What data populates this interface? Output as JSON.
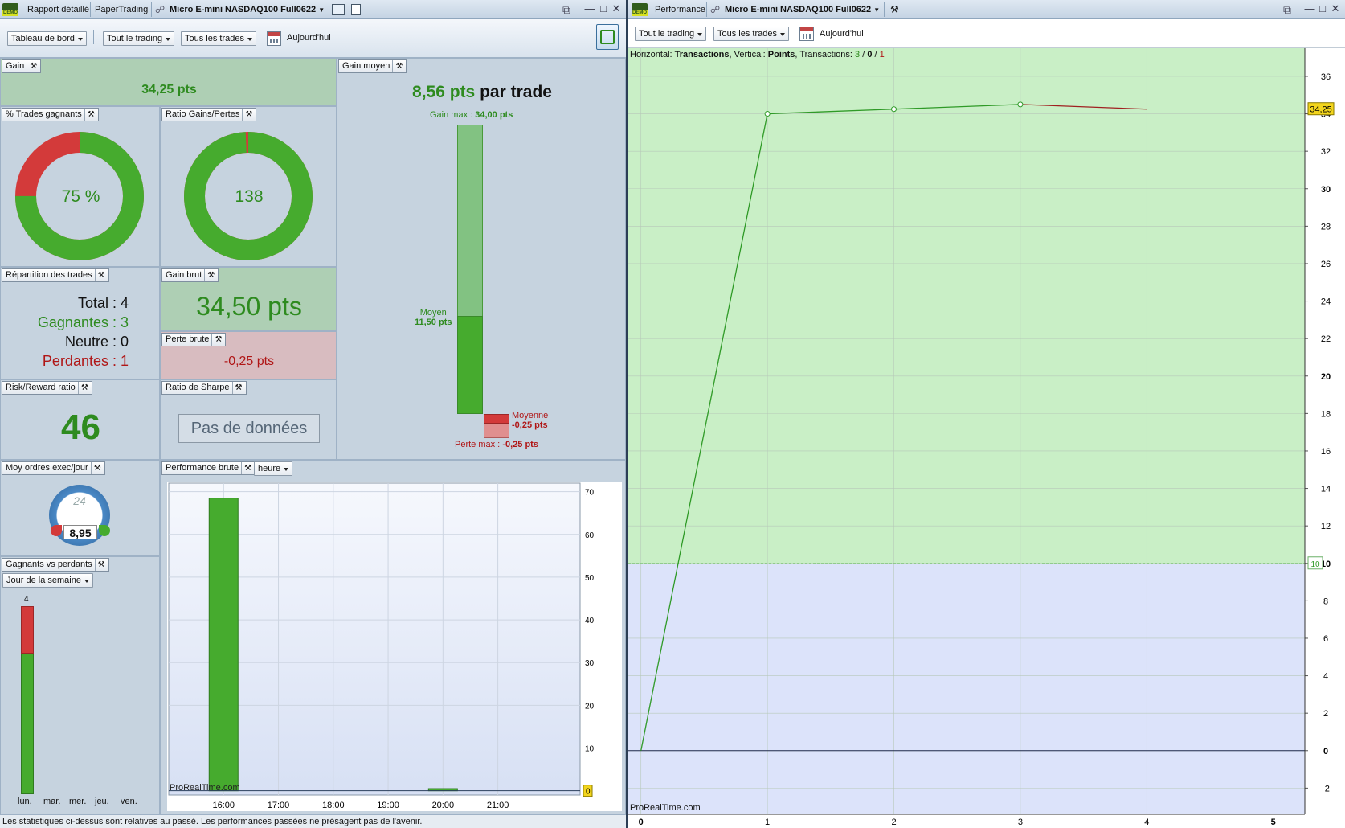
{
  "left_window": {
    "tabs": [
      "Rapport détaillé",
      "PaperTrading"
    ],
    "instrument": "Micro E-mini NASDAQ100 Full0622",
    "toolbar": {
      "dashboard": "Tableau de bord",
      "trading": "Tout le trading",
      "trades": "Tous les trades",
      "date": "Aujourd'hui"
    }
  },
  "right_window": {
    "title": "Performance",
    "instrument": "Micro E-mini NASDAQ100 Full0622",
    "toolbar": {
      "trading": "Tout le trading",
      "trades": "Tous les trades",
      "date": "Aujourd'hui"
    }
  },
  "demo_label": "DEMO",
  "colors": {
    "green": "#2e8b1f",
    "red": "#b01616",
    "bar_green": "#46ab2e",
    "bar_red": "#d33a3a"
  },
  "gain": {
    "label": "Gain",
    "value": "34,25 pts"
  },
  "win_pct": {
    "label": "% Trades gagnants",
    "value": "75 %",
    "fraction": 0.75
  },
  "ratio": {
    "label": "Ratio Gains/Pertes",
    "value": "138",
    "fraction": 0.993
  },
  "avg_gain": {
    "label": "Gain moyen",
    "headline_value": "8,56 pts",
    "headline_suffix": "par trade",
    "max_gain_label": "Gain max :",
    "max_gain_value": "34,00 pts",
    "avg_label": "Moyen",
    "avg_value": "11,50 pts",
    "loss_avg_label": "Moyenne",
    "loss_avg_value": "-0,25 pts",
    "max_loss_label": "Perte max :",
    "max_loss_value": "-0,25 pts",
    "max_gain": 34.0,
    "avg_gain": 11.5
  },
  "distribution": {
    "label": "Répartition des trades",
    "total": "Total : 4",
    "winners": "Gagnantes : 3",
    "neutral": "Neutre : 0",
    "losers": "Perdantes : 1"
  },
  "gross_gain": {
    "label": "Gain brut",
    "value": "34,50 pts"
  },
  "gross_loss": {
    "label": "Perte brute",
    "value": "-0,25 pts"
  },
  "risk_reward": {
    "label": "Risk/Reward ratio",
    "value": "46"
  },
  "sharpe": {
    "label": "Ratio de Sharpe",
    "value": "Pas de données"
  },
  "orders_per_day": {
    "label": "Moy ordres exec/jour",
    "value": "8,95",
    "clock_label": "24"
  },
  "winners_losers": {
    "label": "Gagnants vs perdants",
    "dropdown": "Jour de la semaine",
    "max_label": "4",
    "days": [
      "lun.",
      "mar.",
      "mer.",
      "jeu.",
      "ven."
    ],
    "wins": [
      3,
      0,
      0,
      0,
      0
    ],
    "losses": [
      1,
      0,
      0,
      0,
      0
    ]
  },
  "perf_brute": {
    "label": "Performance brute",
    "dropdown": "heure",
    "watermark": "ProRealTime.com",
    "zero_label": "0",
    "chart_data": {
      "type": "bar",
      "categories": [
        "16:00",
        "17:00",
        "18:00",
        "19:00",
        "20:00",
        "21:00"
      ],
      "values": [
        68.5,
        0,
        0,
        0,
        0.5,
        0
      ],
      "y_ticks": [
        "10",
        "20",
        "30",
        "40",
        "50",
        "60",
        "70"
      ],
      "ylim": [
        -1,
        72
      ]
    }
  },
  "performance_chart": {
    "info_prefix": "Horizontal: ",
    "info_x": "Transactions",
    "info_mid": ", Vertical: ",
    "info_y": "Points",
    "info_tx": ", Transactions: ",
    "info_wins": "3",
    "info_slash1": " / ",
    "info_neutral": "0",
    "info_slash2": " / ",
    "info_losses": "1",
    "watermark": "ProRealTime.com",
    "last_label": "34,25",
    "threshold_label": "10",
    "chart_data": {
      "type": "line",
      "x": [
        0,
        1,
        2,
        3,
        4
      ],
      "y": [
        0,
        34.0,
        34.25,
        34.5,
        34.25
      ],
      "xlim": [
        -0.1,
        5.25
      ],
      "ylim": [
        -3.4,
        37.5
      ],
      "x_ticks": [
        "0",
        "1",
        "2",
        "3",
        "4",
        "5"
      ],
      "y_ticks": [
        "-2",
        "0",
        "2",
        "4",
        "6",
        "8",
        "10",
        "12",
        "14",
        "16",
        "18",
        "20",
        "22",
        "24",
        "26",
        "28",
        "30",
        "32",
        "34",
        "36"
      ],
      "threshold": 10
    }
  },
  "footer": "Les statistiques ci-dessus sont relatives au passé. Les performances passées ne présagent pas de l'avenir."
}
